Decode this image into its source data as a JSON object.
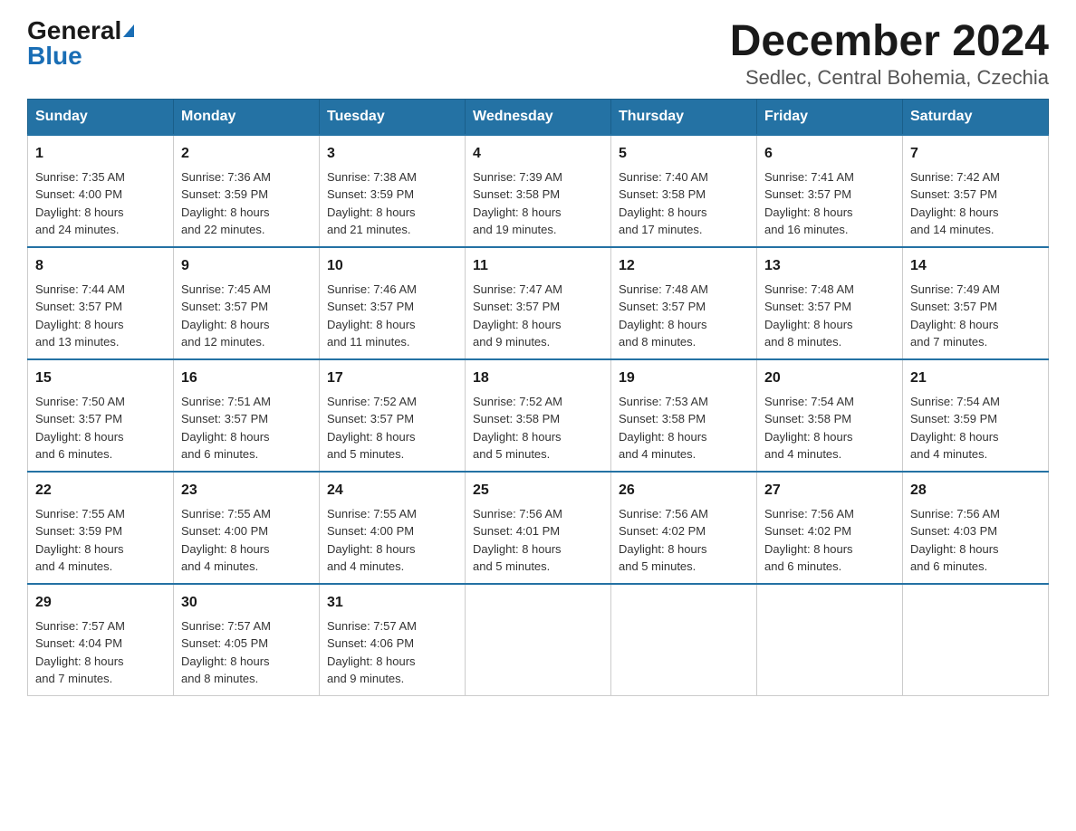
{
  "logo": {
    "general": "General",
    "blue": "Blue"
  },
  "title": {
    "month": "December 2024",
    "location": "Sedlec, Central Bohemia, Czechia"
  },
  "weekdays": [
    "Sunday",
    "Monday",
    "Tuesday",
    "Wednesday",
    "Thursday",
    "Friday",
    "Saturday"
  ],
  "weeks": [
    [
      {
        "day": "1",
        "sunrise": "7:35 AM",
        "sunset": "4:00 PM",
        "daylight": "8 hours and 24 minutes."
      },
      {
        "day": "2",
        "sunrise": "7:36 AM",
        "sunset": "3:59 PM",
        "daylight": "8 hours and 22 minutes."
      },
      {
        "day": "3",
        "sunrise": "7:38 AM",
        "sunset": "3:59 PM",
        "daylight": "8 hours and 21 minutes."
      },
      {
        "day": "4",
        "sunrise": "7:39 AM",
        "sunset": "3:58 PM",
        "daylight": "8 hours and 19 minutes."
      },
      {
        "day": "5",
        "sunrise": "7:40 AM",
        "sunset": "3:58 PM",
        "daylight": "8 hours and 17 minutes."
      },
      {
        "day": "6",
        "sunrise": "7:41 AM",
        "sunset": "3:57 PM",
        "daylight": "8 hours and 16 minutes."
      },
      {
        "day": "7",
        "sunrise": "7:42 AM",
        "sunset": "3:57 PM",
        "daylight": "8 hours and 14 minutes."
      }
    ],
    [
      {
        "day": "8",
        "sunrise": "7:44 AM",
        "sunset": "3:57 PM",
        "daylight": "8 hours and 13 minutes."
      },
      {
        "day": "9",
        "sunrise": "7:45 AM",
        "sunset": "3:57 PM",
        "daylight": "8 hours and 12 minutes."
      },
      {
        "day": "10",
        "sunrise": "7:46 AM",
        "sunset": "3:57 PM",
        "daylight": "8 hours and 11 minutes."
      },
      {
        "day": "11",
        "sunrise": "7:47 AM",
        "sunset": "3:57 PM",
        "daylight": "8 hours and 9 minutes."
      },
      {
        "day": "12",
        "sunrise": "7:48 AM",
        "sunset": "3:57 PM",
        "daylight": "8 hours and 8 minutes."
      },
      {
        "day": "13",
        "sunrise": "7:48 AM",
        "sunset": "3:57 PM",
        "daylight": "8 hours and 8 minutes."
      },
      {
        "day": "14",
        "sunrise": "7:49 AM",
        "sunset": "3:57 PM",
        "daylight": "8 hours and 7 minutes."
      }
    ],
    [
      {
        "day": "15",
        "sunrise": "7:50 AM",
        "sunset": "3:57 PM",
        "daylight": "8 hours and 6 minutes."
      },
      {
        "day": "16",
        "sunrise": "7:51 AM",
        "sunset": "3:57 PM",
        "daylight": "8 hours and 6 minutes."
      },
      {
        "day": "17",
        "sunrise": "7:52 AM",
        "sunset": "3:57 PM",
        "daylight": "8 hours and 5 minutes."
      },
      {
        "day": "18",
        "sunrise": "7:52 AM",
        "sunset": "3:58 PM",
        "daylight": "8 hours and 5 minutes."
      },
      {
        "day": "19",
        "sunrise": "7:53 AM",
        "sunset": "3:58 PM",
        "daylight": "8 hours and 4 minutes."
      },
      {
        "day": "20",
        "sunrise": "7:54 AM",
        "sunset": "3:58 PM",
        "daylight": "8 hours and 4 minutes."
      },
      {
        "day": "21",
        "sunrise": "7:54 AM",
        "sunset": "3:59 PM",
        "daylight": "8 hours and 4 minutes."
      }
    ],
    [
      {
        "day": "22",
        "sunrise": "7:55 AM",
        "sunset": "3:59 PM",
        "daylight": "8 hours and 4 minutes."
      },
      {
        "day": "23",
        "sunrise": "7:55 AM",
        "sunset": "4:00 PM",
        "daylight": "8 hours and 4 minutes."
      },
      {
        "day": "24",
        "sunrise": "7:55 AM",
        "sunset": "4:00 PM",
        "daylight": "8 hours and 4 minutes."
      },
      {
        "day": "25",
        "sunrise": "7:56 AM",
        "sunset": "4:01 PM",
        "daylight": "8 hours and 5 minutes."
      },
      {
        "day": "26",
        "sunrise": "7:56 AM",
        "sunset": "4:02 PM",
        "daylight": "8 hours and 5 minutes."
      },
      {
        "day": "27",
        "sunrise": "7:56 AM",
        "sunset": "4:02 PM",
        "daylight": "8 hours and 6 minutes."
      },
      {
        "day": "28",
        "sunrise": "7:56 AM",
        "sunset": "4:03 PM",
        "daylight": "8 hours and 6 minutes."
      }
    ],
    [
      {
        "day": "29",
        "sunrise": "7:57 AM",
        "sunset": "4:04 PM",
        "daylight": "8 hours and 7 minutes."
      },
      {
        "day": "30",
        "sunrise": "7:57 AM",
        "sunset": "4:05 PM",
        "daylight": "8 hours and 8 minutes."
      },
      {
        "day": "31",
        "sunrise": "7:57 AM",
        "sunset": "4:06 PM",
        "daylight": "8 hours and 9 minutes."
      },
      null,
      null,
      null,
      null
    ]
  ],
  "labels": {
    "sunrise": "Sunrise: ",
    "sunset": "Sunset: ",
    "daylight": "Daylight: "
  }
}
